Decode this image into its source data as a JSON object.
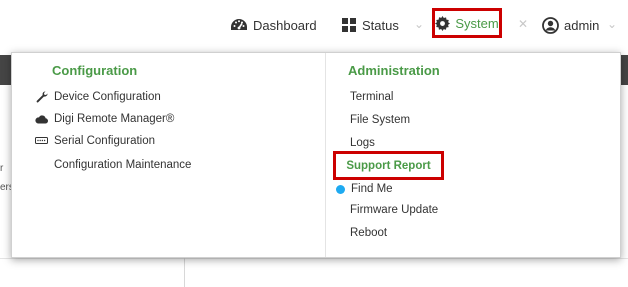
{
  "nav": {
    "dashboard_label": "Dashboard",
    "status_label": "Status",
    "system_label": "System",
    "admin_label": "admin"
  },
  "background": {
    "fragment_1": "r",
    "fragment_2": "ers"
  },
  "dropdown": {
    "configuration": {
      "heading": "Configuration",
      "items": [
        {
          "label": "Device Configuration",
          "icon": "wrench-icon"
        },
        {
          "label": "Digi Remote Manager®",
          "icon": "cloud-icon"
        },
        {
          "label": "Serial Configuration",
          "icon": "serial-port-icon"
        },
        {
          "label": "Configuration Maintenance",
          "icon": ""
        }
      ]
    },
    "administration": {
      "heading": "Administration",
      "items": [
        {
          "label": "Terminal"
        },
        {
          "label": "File System"
        },
        {
          "label": "Logs"
        },
        {
          "label": "Support Report",
          "highlighted": true
        },
        {
          "label": "Find Me",
          "icon": "blue-dot-icon"
        },
        {
          "label": "Firmware Update"
        },
        {
          "label": "Reboot"
        }
      ]
    }
  },
  "colors": {
    "accent_green": "#4a9a47",
    "highlight_red": "#cc0000",
    "findme_blue": "#1eaaf1",
    "dark_band": "#454545"
  }
}
